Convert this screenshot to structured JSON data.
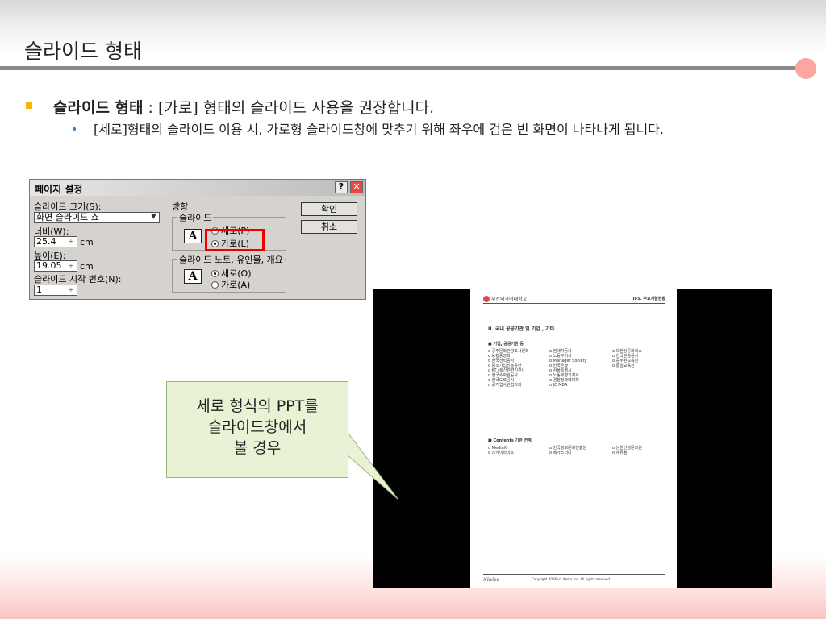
{
  "page_title": "슬라이드 형태",
  "bullet1": {
    "strong": "슬라이드 형태",
    "rest": ": [가로] 형태의 슬라이드 사용을 권장합니다."
  },
  "bullet2": "[세로]형태의 슬라이드 이용 시, 가로형 슬라이드창에 맞추기 위해 좌우에 검은 빈 화면이 나타나게 됩니다.",
  "bullet2_marker": "•",
  "dialog": {
    "title": "페이지 설정",
    "help": "?",
    "close": "✕",
    "slide_size_label": "슬라이드 크기(S):",
    "slide_size_value": "화면 슬라이드 쇼",
    "width_label": "너비(W):",
    "width_value": "25.4",
    "height_label": "높이(E):",
    "height_value": "19.05",
    "unit": "cm",
    "start_label": "슬라이드 시작 번호(N):",
    "start_value": "1",
    "orientation_label": "방향",
    "slides_group": "슬라이드",
    "slides_portrait": "세로(P)",
    "slides_landscape": "가로(L)",
    "notes_group": "슬라이드 노트, 유인물, 개요",
    "notes_portrait": "세로(O)",
    "notes_landscape": "가로(A)",
    "ok": "확인",
    "cancel": "취소",
    "A": "A"
  },
  "doc": {
    "logo": "부산외국어대학교",
    "section": "II-5. 주요계열현황",
    "heading": "II. 국내 공공기관 및 기업 , 기타",
    "sub1": "■ 기업, 공공기관 등",
    "col1": [
      "o 공주문화관광조사원회",
      "o 농협중앙회",
      "o 한국전력공사",
      "o 중소기업진흥공단",
      "o KT (통신관련기관)",
      "o 한국수자원공사",
      "o 한국도로공사",
      "o 공기업사원협의회"
    ],
    "col2": [
      "o 현대자동차",
      "o 노동부이사",
      "o Manager Society",
      "o 한국은행",
      "o 서울특별시",
      "o 노동부경기지사",
      "o 경찰청과학대학",
      "o JC MBA"
    ],
    "col3": [
      "o 대한상공회의소",
      "o 한국관광공사",
      "o 공무원교육원",
      "o 통일교육원"
    ],
    "sub2": "■ Contents 기관 연계",
    "col4": [
      "o MediaX",
      "o 스카이라이프"
    ],
    "col5": [
      "o 한국정보문화진흥원",
      "o 메가스터디"
    ],
    "col6": [
      "o 남한산성문화원",
      "o 에듀윌"
    ],
    "foot_brand": "Xinics",
    "foot_copy": "Copyright 2006 (c) Xinics Inc. All rights reserved"
  },
  "callout": [
    "세로 형식의 PPT를",
    "슬라이드창에서",
    "볼 경우"
  ],
  "colors": {
    "rule": "#8a8a8a",
    "accent_dot": "#f9a79f",
    "bullet": "#f7b500",
    "highlight": "#ee0000",
    "callout_bg": "#e7f3d4"
  }
}
